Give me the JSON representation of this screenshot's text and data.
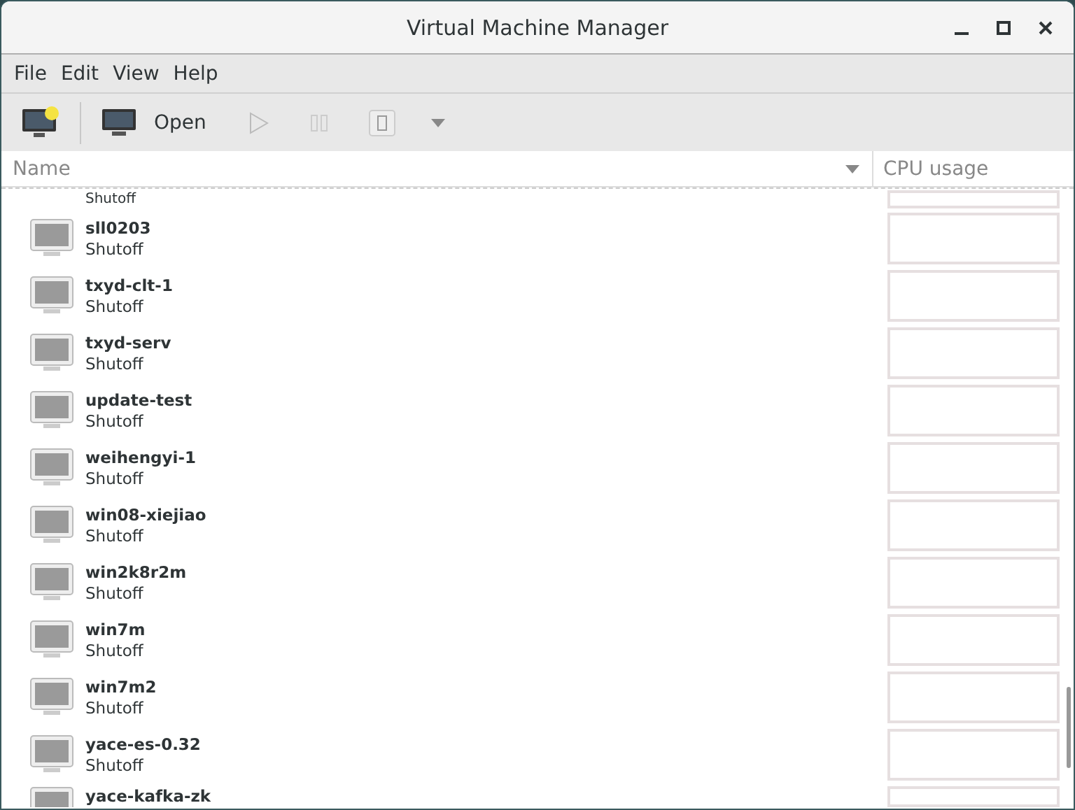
{
  "window": {
    "title": "Virtual Machine Manager"
  },
  "menu": [
    "File",
    "Edit",
    "View",
    "Help"
  ],
  "toolbar": {
    "open_label": "Open"
  },
  "columns": {
    "name": "Name",
    "cpu": "CPU usage"
  },
  "rows": [
    {
      "status": "Shutoff",
      "kind": "partial-top"
    },
    {
      "name": "sll0203",
      "status": "Shutoff",
      "kind": "full"
    },
    {
      "name": "txyd-clt-1",
      "status": "Shutoff",
      "kind": "full"
    },
    {
      "name": "txyd-serv",
      "status": "Shutoff",
      "kind": "full"
    },
    {
      "name": "update-test",
      "status": "Shutoff",
      "kind": "full"
    },
    {
      "name": "weihengyi-1",
      "status": "Shutoff",
      "kind": "full"
    },
    {
      "name": "win08-xiejiao",
      "status": "Shutoff",
      "kind": "full"
    },
    {
      "name": "win2k8r2m",
      "status": "Shutoff",
      "kind": "full"
    },
    {
      "name": "win7m",
      "status": "Shutoff",
      "kind": "full"
    },
    {
      "name": "win7m2",
      "status": "Shutoff",
      "kind": "full"
    },
    {
      "name": "yace-es-0.32",
      "status": "Shutoff",
      "kind": "full"
    },
    {
      "name": "yace-kafka-zk",
      "kind": "partial-bottom"
    }
  ]
}
